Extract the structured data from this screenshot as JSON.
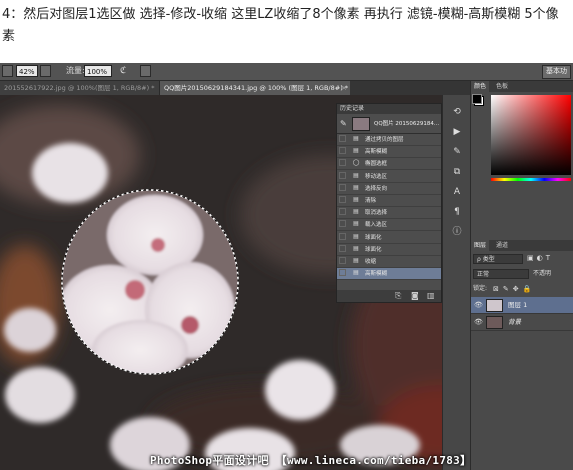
{
  "caption": {
    "text": "4：然后对图层1选区做 选择-修改-收缩 这里LZ收缩了8个像素 再执行 滤镜-模糊-高斯模糊 5个像素"
  },
  "options_bar": {
    "zoom_value": "42%",
    "opacity_label": "流量:",
    "opacity_value": "100%",
    "workspace_label": "基本功"
  },
  "tabs": [
    {
      "label": "201552617922.jpg @ 100%(图层 1, RGB/8#) *"
    },
    {
      "label": "QQ图片20150629184341.jpg @ 100% (图层 1, RGB/8#) *"
    }
  ],
  "history": {
    "title": "历史记录",
    "snapshot_label": "QQ图片 20150629184...",
    "items": [
      {
        "label": "通过拷贝的图层",
        "icon": "document-icon",
        "glyph": "▤"
      },
      {
        "label": "高斯模糊",
        "icon": "document-icon",
        "glyph": "▤"
      },
      {
        "label": "椭圆选框",
        "icon": "ellipse-icon",
        "glyph": "◯"
      },
      {
        "label": "移动选区",
        "icon": "document-icon",
        "glyph": "▤"
      },
      {
        "label": "选择反向",
        "icon": "document-icon",
        "glyph": "▤"
      },
      {
        "label": "清除",
        "icon": "document-icon",
        "glyph": "▤"
      },
      {
        "label": "取消选择",
        "icon": "document-icon",
        "glyph": "▤"
      },
      {
        "label": "载入选区",
        "icon": "document-icon",
        "glyph": "▤"
      },
      {
        "label": "球面化",
        "icon": "document-icon",
        "glyph": "▤"
      },
      {
        "label": "球面化",
        "icon": "document-icon",
        "glyph": "▤"
      },
      {
        "label": "收缩",
        "icon": "document-icon",
        "glyph": "▤"
      },
      {
        "label": "高斯模糊",
        "icon": "document-icon",
        "glyph": "▤",
        "selected": true
      }
    ]
  },
  "color_panel": {
    "tabs": [
      "颜色",
      "色板"
    ]
  },
  "layers_panel": {
    "tabs": [
      "图层",
      "通道"
    ],
    "kind_filter": "ρ 类型",
    "blend_mode": "正常",
    "opacity_label": "不透明",
    "lock_label": "锁定:",
    "layers": [
      {
        "name": "图层 1",
        "selected": true
      },
      {
        "name": "背景",
        "selected": false
      }
    ]
  },
  "watermark": "PhotoShop平面设计吧 【www.lineca.com/tieba/1783】"
}
